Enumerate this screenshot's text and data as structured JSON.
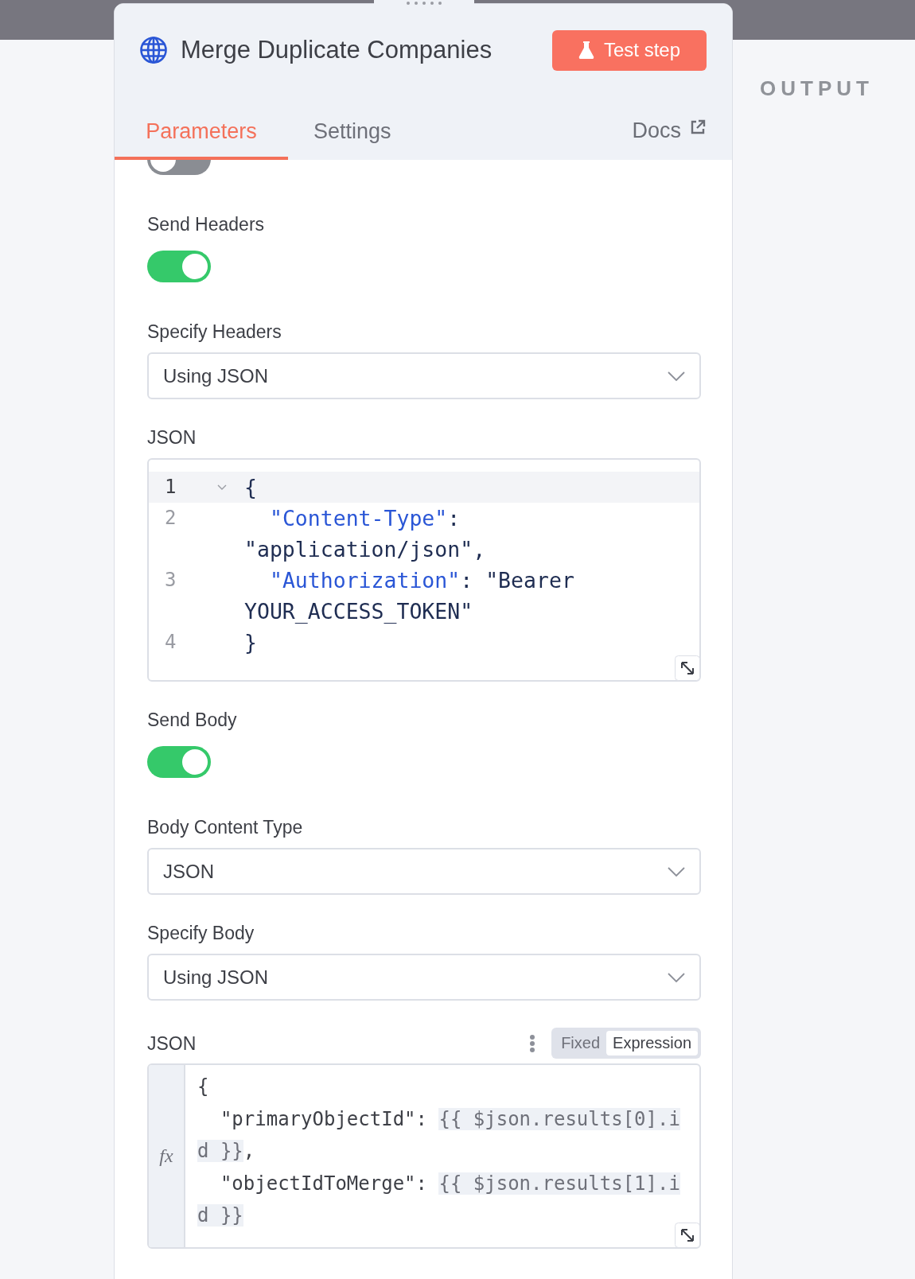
{
  "header": {
    "title": "Merge Duplicate Companies",
    "test_button": "Test step"
  },
  "tabs": [
    {
      "label": "Parameters",
      "selected": true
    },
    {
      "label": "Settings",
      "selected": false
    }
  ],
  "docs_link": "Docs",
  "output_label": "OUTPUT",
  "fields": [
    {
      "kind": "toggle",
      "on": false
    },
    {
      "kind": "toggle",
      "label": "Send Headers",
      "on": true
    },
    {
      "kind": "select",
      "label": "Specify Headers",
      "value": "Using JSON"
    },
    {
      "kind": "code",
      "label": "JSON",
      "lines": [
        {
          "number": "1",
          "active": true,
          "foldable": true,
          "parts": [
            {
              "kind": "text",
              "text": "{"
            }
          ]
        },
        {
          "number": "2",
          "active": false,
          "foldable": false,
          "parts": [
            {
              "kind": "key",
              "text": "  \"Content-Type\""
            },
            {
              "kind": "text",
              "text": ": \"application/json\","
            }
          ]
        },
        {
          "number": "3",
          "active": false,
          "foldable": false,
          "parts": [
            {
              "kind": "key",
              "text": "  \"Authorization\""
            },
            {
              "kind": "text",
              "text": ": \"Bearer YOUR_ACCESS_TOKEN\""
            }
          ]
        },
        {
          "number": "4",
          "active": false,
          "foldable": false,
          "parts": [
            {
              "kind": "text",
              "text": "}"
            }
          ]
        }
      ]
    },
    {
      "kind": "toggle",
      "label": "Send Body",
      "on": true
    },
    {
      "kind": "select",
      "label": "Body Content Type",
      "value": "JSON"
    },
    {
      "kind": "select",
      "label": "Specify Body",
      "value": "Using JSON"
    },
    {
      "kind": "expression",
      "label": "JSON",
      "gutter_label": "fx",
      "modes": [
        {
          "label": "Fixed",
          "selected": false
        },
        {
          "label": "Expression",
          "selected": true
        }
      ],
      "lines": [
        {
          "parts": [
            {
              "kind": "text",
              "text": "{"
            }
          ]
        },
        {
          "parts": [
            {
              "kind": "text",
              "text": "  \"primaryObjectId\": "
            },
            {
              "kind": "expr",
              "text": "{{ $json.results[0].id }}"
            },
            {
              "kind": "text",
              "text": ","
            }
          ]
        },
        {
          "parts": [
            {
              "kind": "text",
              "text": "  \"objectIdToMerge\": "
            },
            {
              "kind": "expr",
              "text": "{{ $json.results[1].id }}"
            }
          ]
        }
      ]
    }
  ]
}
